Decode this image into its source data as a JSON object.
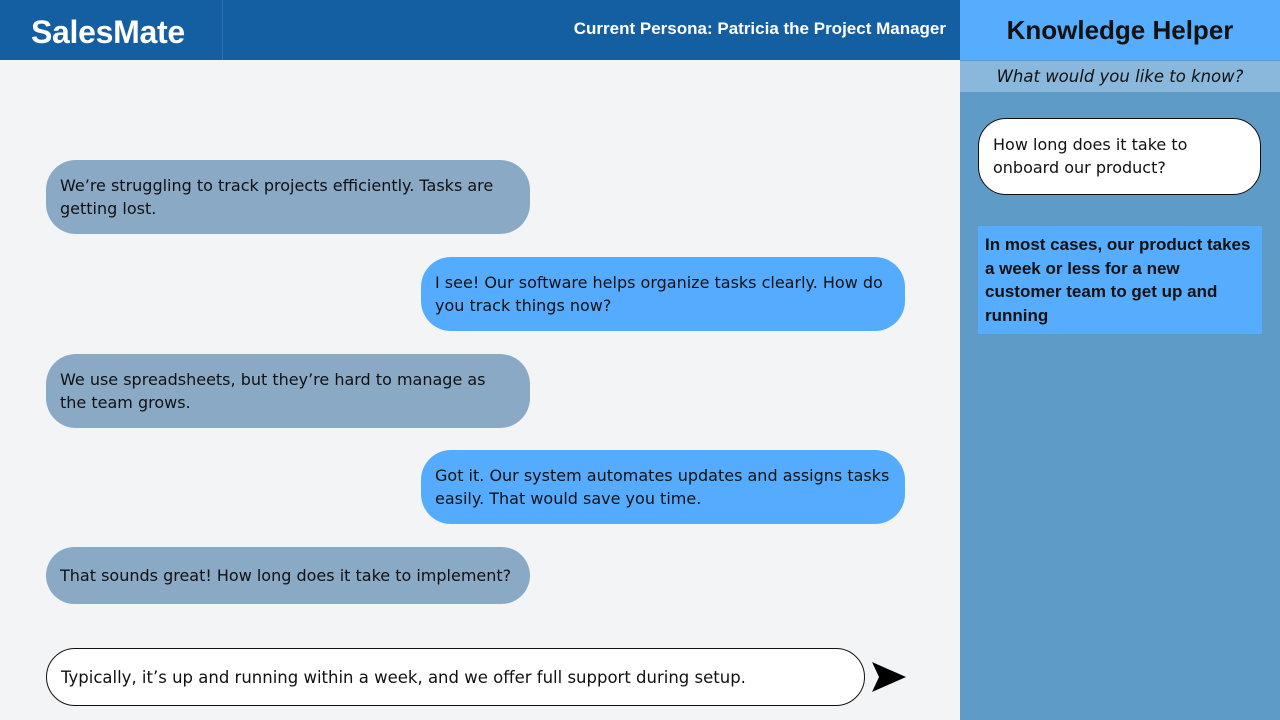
{
  "header": {
    "logo": "SalesMate",
    "persona": "Current Persona: Patricia the Project Manager"
  },
  "messages": [
    {
      "role": "customer",
      "text": "We’re struggling to track projects efficiently. Tasks are getting lost."
    },
    {
      "role": "agent",
      "text": "I see! Our software helps organize tasks clearly. How do you track things now?"
    },
    {
      "role": "customer",
      "text": "We use spreadsheets, but they’re hard to manage as the team grows."
    },
    {
      "role": "agent",
      "text": "Got it. Our system automates updates and assigns tasks easily. That would save you time."
    },
    {
      "role": "customer",
      "text": "That sounds great! How long does it take to implement?"
    }
  ],
  "input": {
    "value": "Typically, it’s up and running within a week, and we offer full support during setup."
  },
  "icons": {
    "send": "send-arrow-icon"
  },
  "sidebar": {
    "title": "Knowledge Helper",
    "subtitle": "What would you like to know?",
    "question": "How long does it take to onboard our product?",
    "answer": "In most cases, our product takes a week or less for a new customer team to get up and running"
  },
  "colors": {
    "header_bg": "#145fa2",
    "customer_bubble": "#89a9c5",
    "agent_bubble": "#55acfe",
    "sidebar_bg": "#5f9bc7",
    "sidebar_header": "#56acfd"
  }
}
